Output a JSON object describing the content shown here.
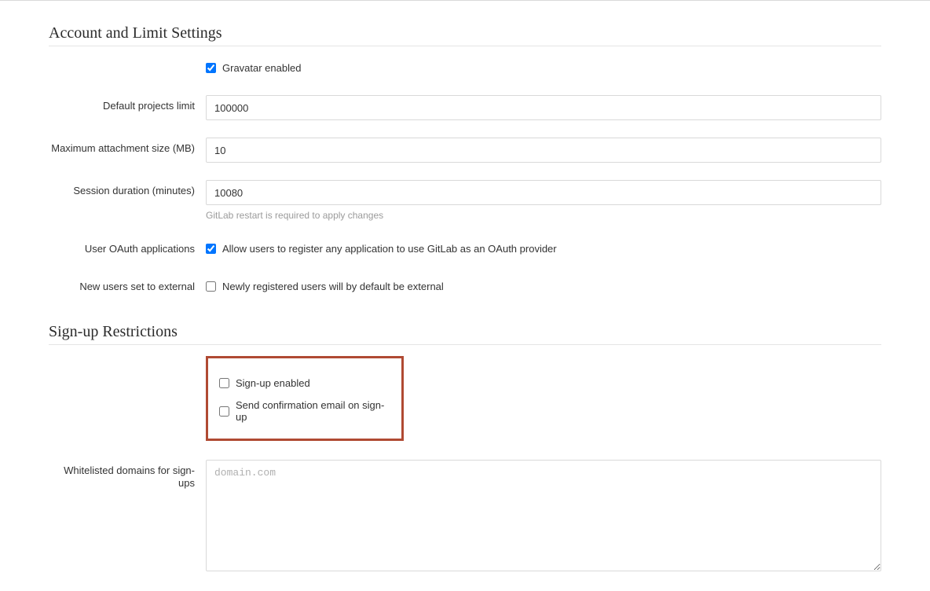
{
  "section1": {
    "title": "Account and Limit Settings",
    "gravatar": {
      "label": "Gravatar enabled",
      "checked": true
    },
    "projects_limit": {
      "label": "Default projects limit",
      "value": "100000"
    },
    "max_attachment": {
      "label": "Maximum attachment size (MB)",
      "value": "10"
    },
    "session_duration": {
      "label": "Session duration (minutes)",
      "value": "10080",
      "help": "GitLab restart is required to apply changes"
    },
    "oauth_apps": {
      "label": "User OAuth applications",
      "checkbox_label": "Allow users to register any application to use GitLab as an OAuth provider",
      "checked": true
    },
    "new_users_external": {
      "label": "New users set to external",
      "checkbox_label": "Newly registered users will by default be external",
      "checked": false
    }
  },
  "section2": {
    "title": "Sign-up Restrictions",
    "signup_enabled": {
      "label": "Sign-up enabled",
      "checked": false
    },
    "send_confirmation": {
      "label": "Send confirmation email on sign-up",
      "checked": false
    },
    "whitelist": {
      "label": "Whitelisted domains for sign-ups",
      "placeholder": "domain.com",
      "value": ""
    }
  }
}
